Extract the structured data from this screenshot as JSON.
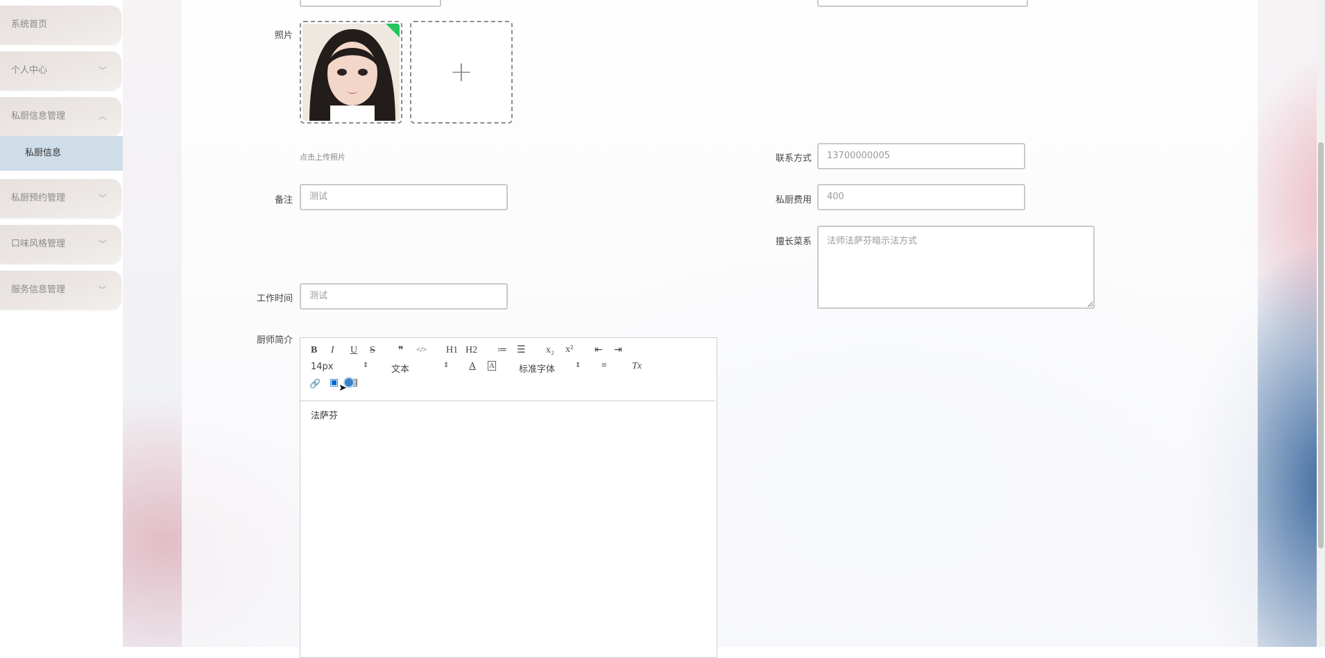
{
  "sidebar": {
    "items": [
      {
        "label": "系统首页"
      },
      {
        "label": "个人中心"
      },
      {
        "label": "私厨信息管理"
      },
      {
        "label": "私厨预约管理"
      },
      {
        "label": "口味风格管理"
      },
      {
        "label": "服务信息管理"
      }
    ],
    "sub_item": {
      "label": "私厨信息"
    }
  },
  "form": {
    "photo": {
      "label": "照片",
      "hint": "点击上传照片"
    },
    "remark": {
      "label": "备注",
      "value": "测试"
    },
    "contact": {
      "label": "联系方式",
      "value": "13700000005"
    },
    "fee": {
      "label": "私厨费用",
      "value": "400"
    },
    "cuisine": {
      "label": "擅长菜系",
      "value": "法师法萨芬暗示法方式"
    },
    "work_time": {
      "label": "工作时间",
      "value": "测试"
    },
    "intro": {
      "label": "厨师简介",
      "content": "法萨芬"
    }
  },
  "editor_toolbar": {
    "bold": "B",
    "italic": "I",
    "underline": "U",
    "strike": "S",
    "quote": "❞",
    "code": "</>",
    "h1": "H1",
    "h2": "H2",
    "ordered_list": "≔",
    "bullet_list": "☰",
    "sub": "x₂",
    "sup": "x²",
    "indent_out": "⇤",
    "indent_in": "⇥",
    "size_value": "14px",
    "header_value": "文本",
    "font_value": "标准字体",
    "color": "A",
    "background": "A",
    "align": "≡",
    "clean": "Tx",
    "link": "🔗",
    "image": "▣",
    "video": "▤"
  },
  "colors": {
    "accent": "#cfdde9",
    "menu": "#e7e1de"
  }
}
